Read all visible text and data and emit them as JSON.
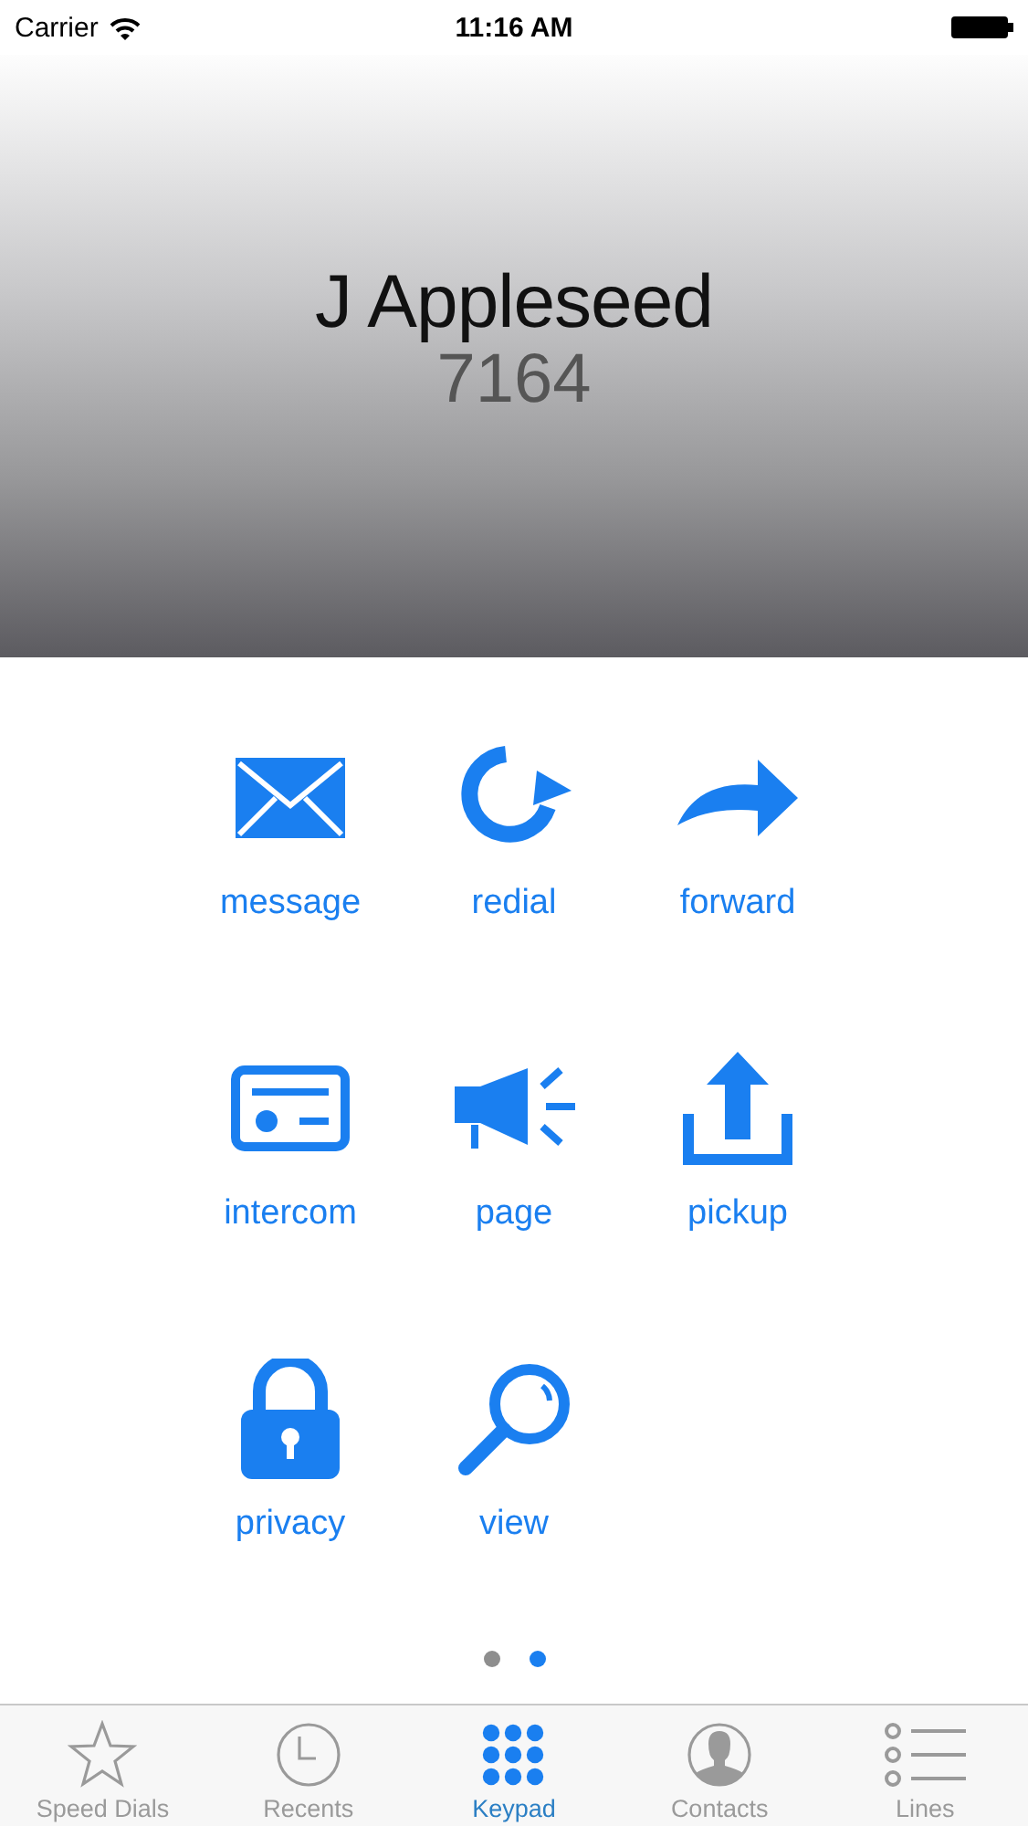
{
  "status_bar": {
    "carrier": "Carrier",
    "time": "11:16 AM"
  },
  "contact": {
    "name": "J Appleseed",
    "extension": "7164"
  },
  "actions": [
    {
      "label": "message"
    },
    {
      "label": "redial"
    },
    {
      "label": "forward"
    },
    {
      "label": "intercom"
    },
    {
      "label": "page"
    },
    {
      "label": "pickup"
    },
    {
      "label": "privacy"
    },
    {
      "label": "view"
    }
  ],
  "page_dots": [
    {
      "selected": false
    },
    {
      "selected": true
    }
  ],
  "tabs": [
    {
      "label": "Speed Dials",
      "selected": false
    },
    {
      "label": "Recents",
      "selected": false
    },
    {
      "label": "Keypad",
      "selected": true
    },
    {
      "label": "Contacts",
      "selected": false
    },
    {
      "label": "Lines",
      "selected": false
    }
  ]
}
